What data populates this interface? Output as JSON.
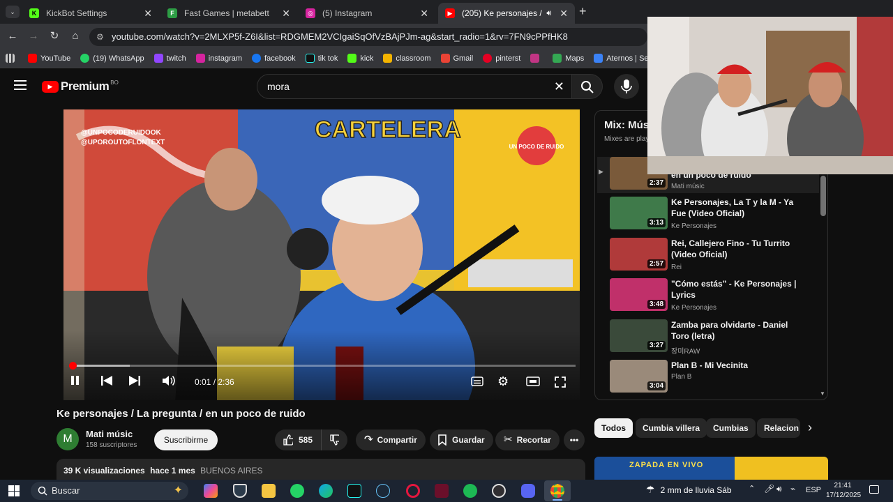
{
  "browser": {
    "tabs": [
      {
        "title": "KickBot Settings",
        "color": "#53fc18",
        "glyph": "K"
      },
      {
        "title": "Fast Games | metabett",
        "color": "#2d9d45",
        "glyph": "F"
      },
      {
        "title": "(5) Instagram",
        "color": "#d6249f",
        "glyph": "◎"
      },
      {
        "title": "(205) Ke personajes / La pre",
        "color": "#ff0000",
        "glyph": "▶"
      }
    ],
    "url": "youtube.com/watch?v=2MLXP5f-Z6I&list=RDGMEM2VCIgaiSqOfVzBAjPJm-ag&start_radio=1&rv=7FN9cPPfHK8",
    "bookmarks": [
      {
        "label": "YouTube",
        "color": "#ff0000"
      },
      {
        "label": "(19) WhatsApp",
        "color": "#25d366"
      },
      {
        "label": "twitch",
        "color": "#9146ff"
      },
      {
        "label": "instagram",
        "color": "#d6249f"
      },
      {
        "label": "facebook",
        "color": "#1877f2"
      },
      {
        "label": "tik tok",
        "color": "#111111"
      },
      {
        "label": "kick",
        "color": "#53fc18"
      },
      {
        "label": "classroom",
        "color": "#f4b400"
      },
      {
        "label": "Gmail",
        "color": "#ea4335"
      },
      {
        "label": "pinterst",
        "color": "#e60023"
      },
      {
        "label": "",
        "color": "#c13584"
      },
      {
        "label": "Maps",
        "color": "#34a853"
      },
      {
        "label": "Aternos | Servidores...",
        "color": "#3b82f6"
      }
    ]
  },
  "yt": {
    "logo": "Premium",
    "region": "BO",
    "search": "mora",
    "time": "0:01 / 2:36",
    "progress": 0.007,
    "buffered": 0.12,
    "title": "Ke personajes / La pregunta / en un poco de ruido",
    "avatar_letter": "M",
    "channel": "Mati músic",
    "subs": "158 suscriptores",
    "subscribe": "Suscribirme",
    "likes": "585",
    "share": "Compartir",
    "save": "Guardar",
    "clip": "Recortar",
    "desc_views": "39 K visualizaciones",
    "desc_time": "hace 1 mes",
    "desc_place": "BUENOS AIRES",
    "overlay_tag1": "@UNPOCODERUIDOOK",
    "overlay_tag2": "@UPOROUTOFLONTEXT",
    "overlay_logo": "UN POCO DE RUIDO",
    "overlay_sign": "CARTELERA"
  },
  "playlist": {
    "title": "Mix: Mús",
    "subtitle": "Mixes are playlists",
    "items": [
      {
        "title": "en un poco de ruido",
        "channel": "Mati músic",
        "duration": "2:37",
        "color": "#7a5a3a"
      },
      {
        "title": "Ke Personajes, La T y la M - Ya Fue (Video Oficial)",
        "channel": "Ke Personajes",
        "duration": "3:13",
        "color": "#3f7a4a"
      },
      {
        "title": "Rei, Callejero Fino - Tu Turrito (Video Oficial)",
        "channel": "Rei",
        "duration": "2:57",
        "color": "#b03a3a"
      },
      {
        "title": "\"Cómo estás\" - Ke Personajes | Lyrics",
        "channel": "Ke Personajes",
        "duration": "3:48",
        "color": "#c0306a"
      },
      {
        "title": "Zamba para olvidarte - Daniel Toro (letra)",
        "channel": "장미RAW",
        "duration": "3:27",
        "color": "#3a4a3a"
      },
      {
        "title": "Plan B - Mi Vecinita",
        "channel": "Plan B",
        "duration": "3:04",
        "color": "#9a8a7a"
      }
    ]
  },
  "chips": [
    "Todos",
    "Cumbia villera",
    "Cumbias",
    "Relacion"
  ],
  "banner_text": "ZAPADA EN VIVO",
  "taskbar": {
    "search": "Buscar",
    "weather": "2 mm de lluvia Sáb",
    "lang": "ESP",
    "time": "21:41",
    "date": "17/12/2025"
  }
}
